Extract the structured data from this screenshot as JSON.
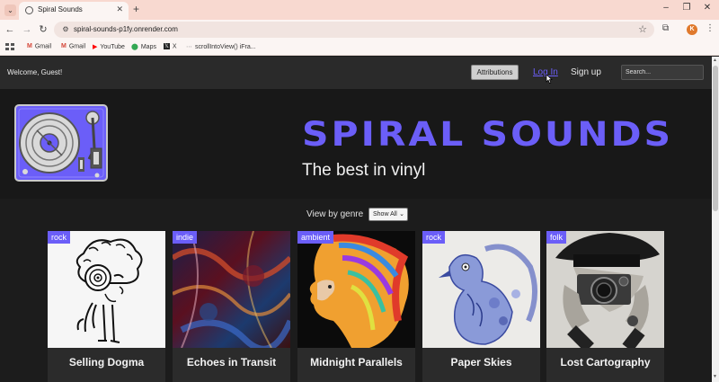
{
  "browser": {
    "tab_title": "Spiral Sounds",
    "url": "spiral-sounds-p1fy.onrender.com",
    "profile_initial": "K",
    "bookmarks": [
      "Gmail",
      "Gmail",
      "YouTube",
      "Maps",
      "X",
      "scrollIntoView() iFra..."
    ]
  },
  "nav": {
    "welcome": "Welcome, Guest!",
    "attributions": "Attributions",
    "login": "Log In",
    "signup": "Sign up",
    "search_placeholder": "Search..."
  },
  "hero": {
    "title": "SPIRAL SOUNDS",
    "tagline": "The best in vinyl"
  },
  "filter": {
    "label": "View by genre",
    "selected": "Show All"
  },
  "products": [
    {
      "genre": "rock",
      "title": "Selling Dogma"
    },
    {
      "genre": "indie",
      "title": "Echoes in Transit"
    },
    {
      "genre": "ambient",
      "title": "Midnight Parallels"
    },
    {
      "genre": "rock",
      "title": "Paper Skies"
    },
    {
      "genre": "folk",
      "title": "Lost Cartography"
    }
  ],
  "colors": {
    "accent": "#6b5ef8",
    "page_bg": "#1c1c1c",
    "nav_bg": "#2a2a2a"
  }
}
